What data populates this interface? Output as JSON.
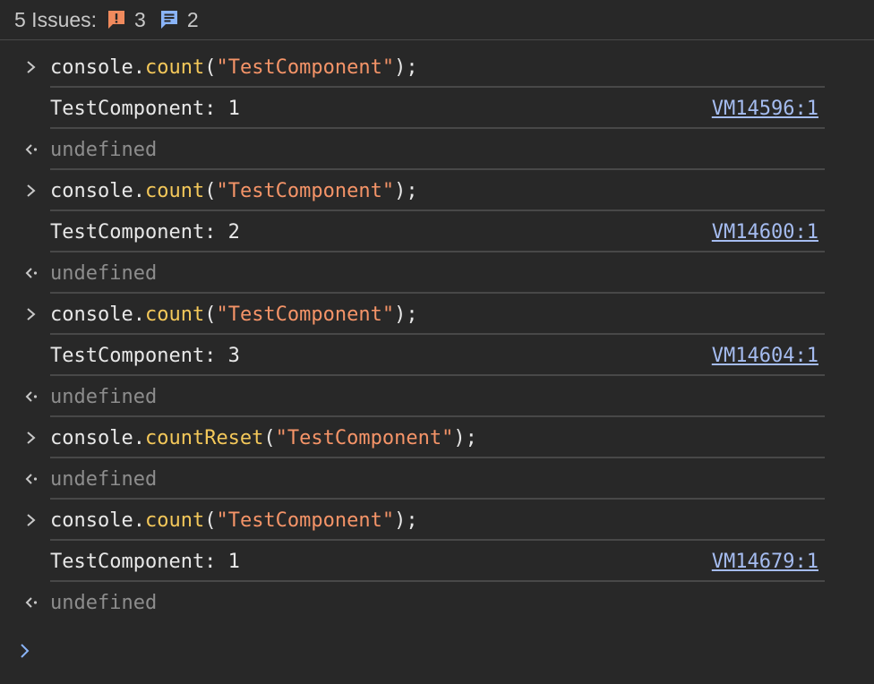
{
  "issues": {
    "label": "5 Issues:",
    "error_count": "3",
    "info_count": "2",
    "colors": {
      "error": "#f08a5d",
      "info": "#8ab4f8"
    }
  },
  "entries": [
    {
      "kind": "input",
      "obj": "console.",
      "method": "count",
      "open": "(",
      "arg": "\"TestComponent\"",
      "close": ");"
    },
    {
      "kind": "log",
      "text": "TestComponent: 1",
      "source": "VM14596:1"
    },
    {
      "kind": "result",
      "text": "undefined"
    },
    {
      "kind": "input",
      "obj": "console.",
      "method": "count",
      "open": "(",
      "arg": "\"TestComponent\"",
      "close": ");"
    },
    {
      "kind": "log",
      "text": "TestComponent: 2",
      "source": "VM14600:1"
    },
    {
      "kind": "result",
      "text": "undefined"
    },
    {
      "kind": "input",
      "obj": "console.",
      "method": "count",
      "open": "(",
      "arg": "\"TestComponent\"",
      "close": ");"
    },
    {
      "kind": "log",
      "text": "TestComponent: 3",
      "source": "VM14604:1"
    },
    {
      "kind": "result",
      "text": "undefined"
    },
    {
      "kind": "input",
      "obj": "console.",
      "method": "countReset",
      "open": "(",
      "arg": "\"TestComponent\"",
      "close": ");"
    },
    {
      "kind": "result",
      "text": "undefined"
    },
    {
      "kind": "input",
      "obj": "console.",
      "method": "count",
      "open": "(",
      "arg": "\"TestComponent\"",
      "close": ");"
    },
    {
      "kind": "log",
      "text": "TestComponent: 1",
      "source": "VM14679:1"
    },
    {
      "kind": "result",
      "text": "undefined"
    }
  ],
  "icons": {
    "input_prompt": "chevron-right-icon",
    "result_prompt": "return-arrow-icon",
    "error": "exclamation-message-icon",
    "info": "message-lines-icon"
  },
  "colors": {
    "background": "#282828",
    "method": "#f4c85a",
    "string": "#f59468",
    "link": "#a5bcf0",
    "muted": "#8d8d8d",
    "prompt": "#8ab4f8"
  }
}
